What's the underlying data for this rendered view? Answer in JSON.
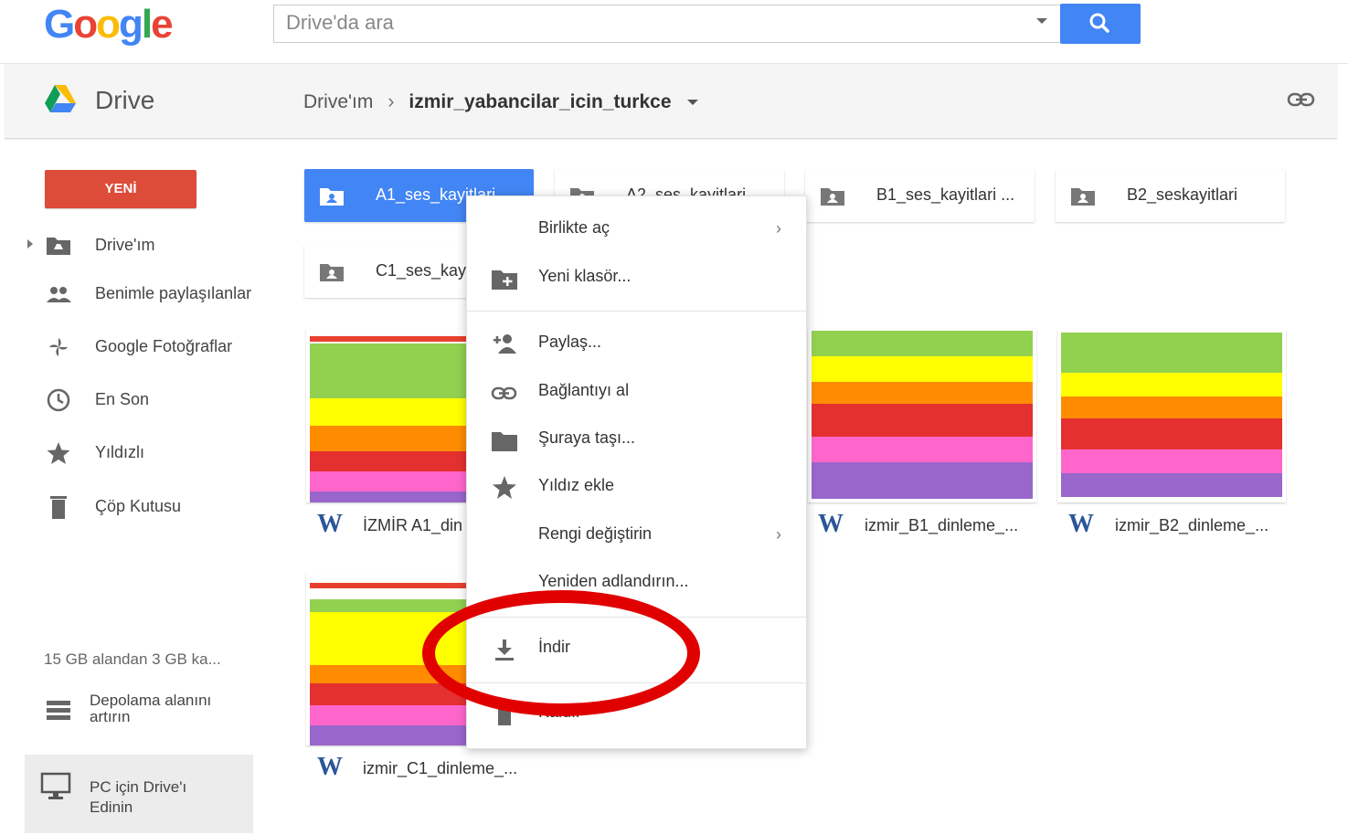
{
  "header": {
    "logo": "Google",
    "search_placeholder": "Drive'da ara"
  },
  "subheader": {
    "app_name": "Drive",
    "breadcrumb_root": "Drive'ım",
    "breadcrumb_sep": "›",
    "breadcrumb_current": "izmir_yabancilar_icin_turkce"
  },
  "sidebar": {
    "new_button": "YENİ",
    "items": [
      {
        "label": "Drive'ım",
        "icon": "my-drive-icon"
      },
      {
        "label": "Benimle paylaşılanlar",
        "icon": "shared-people-icon"
      },
      {
        "label": "Google Fotoğraflar",
        "icon": "photos-pinwheel-icon"
      },
      {
        "label": "En Son",
        "icon": "clock-icon"
      },
      {
        "label": "Yıldızlı",
        "icon": "star-icon"
      },
      {
        "label": "Çöp Kutusu",
        "icon": "trash-icon"
      }
    ],
    "storage_text": "15 GB alandan 3 GB ka...",
    "upgrade_line1": "Depolama alanını",
    "upgrade_line2": "artırın",
    "pc_line1": "PC için Drive'ı",
    "pc_line2": "Edinin"
  },
  "folders": [
    {
      "name": "A1_ses_kayitlari",
      "selected": true
    },
    {
      "name": "A2_ses_kayitlari",
      "selected": false
    },
    {
      "name": "B1_ses_kayitlari ...",
      "selected": false
    },
    {
      "name": "B2_seskayitlari",
      "selected": false
    },
    {
      "name": "C1_ses_kay",
      "selected": false
    }
  ],
  "files": [
    {
      "name": "İZMİR A1_din"
    },
    {
      "name": "izmir_B1_dinleme_..."
    },
    {
      "name": "izmir_B2_dinleme_..."
    },
    {
      "name": "izmir_C1_dinleme_..."
    }
  ],
  "file_type_letter": "W",
  "context_menu": {
    "items": [
      {
        "label": "Birlikte aç",
        "icon": "",
        "arrow": "›"
      },
      {
        "label": "Yeni klasör...",
        "icon": "new-folder-icon"
      },
      {
        "label": "Paylaş...",
        "icon": "share-person-add-icon"
      },
      {
        "label": "Bağlantıyı al",
        "icon": "link-icon"
      },
      {
        "label": "Şuraya taşı...",
        "icon": "folder-move-icon"
      },
      {
        "label": "Yıldız ekle",
        "icon": "star-icon"
      },
      {
        "label": "Rengi değiştirin",
        "icon": "",
        "arrow": "›"
      },
      {
        "label": "Yeniden adlandırın...",
        "icon": ""
      },
      {
        "label": "İndir",
        "icon": "download-icon"
      },
      {
        "label": "Kaldır",
        "icon": "trash-icon"
      }
    ]
  },
  "colors": {
    "accent_blue": "#4285f4",
    "new_red": "#dd4b39",
    "annotation_red": "#e10000"
  }
}
